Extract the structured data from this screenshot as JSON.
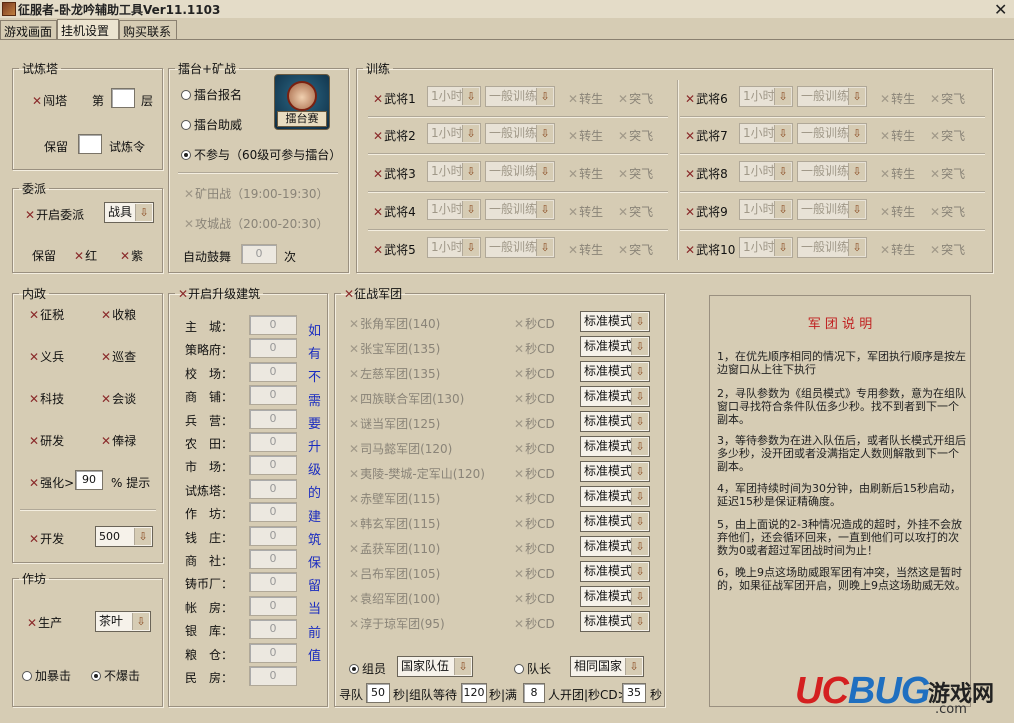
{
  "window": {
    "title": "征服者-卧龙吟辅助工具Ver11.1103",
    "close": "✕"
  },
  "tabs": [
    "游戏画面",
    "挂机设置",
    "购买联系"
  ],
  "shilianta": {
    "legend": "试炼塔",
    "chuangta": "闯塔",
    "di": "第",
    "ceng": "层",
    "baoliu": "保留",
    "shilianling": "试炼令",
    "floor_value": "",
    "keep_value": ""
  },
  "weipai": {
    "legend": "委派",
    "kaiqi": "开启委派",
    "drop": "战具",
    "baoliu": "保留",
    "hong": "红",
    "zi": "紫"
  },
  "leitai": {
    "legend": "擂台+矿战",
    "baoming": "擂台报名",
    "zhuwei": "擂台助威",
    "bucanyu": "不参与（60级可参与擂台）",
    "kuangtian": "矿田战（19:00-19:30）",
    "gongcheng": "攻城战（20:00-20:30）",
    "gushu": "自动鼓舞",
    "gushu_value": "0",
    "ci": "次",
    "pvp_caption": "擂台赛"
  },
  "xunlian": {
    "legend": "训练",
    "generals": [
      "武将1",
      "武将2",
      "武将3",
      "武将4",
      "武将5",
      "武将6",
      "武将7",
      "武将8",
      "武将9",
      "武将10"
    ],
    "time": "1小时",
    "mode": "一般训练",
    "zhuansheng": "转生",
    "tufei": "突飞"
  },
  "neizheng": {
    "legend": "内政",
    "items": [
      "征税",
      "收粮",
      "义兵",
      "巡查",
      "科技",
      "会谈",
      "研发",
      "俸禄"
    ],
    "qianghua": "强化>",
    "qianghua_value": "90",
    "tishi": "% 提示",
    "kaifa": "开发",
    "kaifa_value": "500"
  },
  "zuofang": {
    "legend": "作坊",
    "shengchan": "生产",
    "drop": "茶叶",
    "baoji": "加暴击",
    "bubaoji": "不爆击"
  },
  "jianzhu": {
    "legend": "开启升级建筑",
    "names": [
      "主　城：",
      "策略府：",
      "校　场：",
      "商　铺：",
      "兵　营：",
      "农　田：",
      "市　场：",
      "试炼塔：",
      "作　坊：",
      "钱　庄：",
      "商　社：",
      "铸币厂：",
      "帐　房：",
      "银　库：",
      "粮　仓：",
      "民　房："
    ],
    "value": "0",
    "hint": [
      "如",
      "有",
      "不",
      "需",
      "要",
      "升",
      "级",
      "的",
      "建",
      "筑",
      "保",
      "留",
      "当",
      "前",
      "值"
    ]
  },
  "juntuan": {
    "legend": "征战军团",
    "items": [
      "张角军团(140)",
      "张宝军团(135)",
      "左慈军团(135)",
      "四族联合军团(130)",
      "谜当军团(125)",
      "司马懿军团(120)",
      "夷陵-樊城-定军山(120)",
      "赤壁军团(115)",
      "韩玄军团(115)",
      "孟获军团(110)",
      "吕布军团(105)",
      "袁绍军团(100)",
      "淳于琼军团(95)"
    ],
    "cd": "秒CD",
    "mode": "标准模式",
    "zuyuan": "组员",
    "zuyuan_drop": "国家队伍",
    "duizhang": "队长",
    "duizhang_drop": "相同国家",
    "bottom": {
      "xundui": "寻队",
      "xundui_v": "50",
      "miao1": "秒|组队等待",
      "wait_v": "120",
      "miao2": "秒|满",
      "full_v": "8",
      "kai": "人开团|秒CD>",
      "cd_v": "35",
      "miao3": "秒"
    }
  },
  "note": {
    "title": "军 团 说 明",
    "paras": [
      "1，在优先顺序相同的情况下，军团执行顺序是按左边窗口从上往下执行",
      "2，寻队参数为《组员模式》专用参数，意为在组队窗口寻找符合条件队伍多少秒。找不到者到下一个副本。",
      "3，等待参数为在进入队伍后，或者队长模式开组后多少秒，没开团或者没满指定人数则解散到下一个副本。",
      "4，军团持续时间为30分钟，由刷新后15秒启动，延迟15秒是保证精确度。",
      "5，由上面说的2-3种情况造成的超时，外挂不会放弃他们，还会循环回来，一直到他们可以攻打的次数为0或者超过军团战时间为止！",
      "6，晚上9点这场助威跟军团有冲突，当然这是暂时的，如果征战军团开启，则晚上9点这场助威无效。"
    ]
  },
  "watermark": {
    "uc": "UC",
    "bug": "BUG",
    "cn": "游戏网",
    "dom": ".com"
  }
}
